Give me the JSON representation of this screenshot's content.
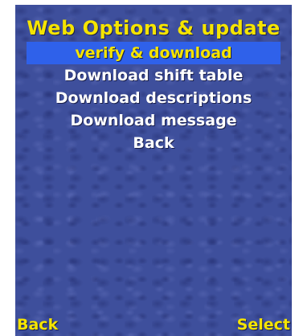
{
  "screen": {
    "title": "Web Options & update"
  },
  "menu": {
    "items": [
      {
        "label": "verify & download",
        "selected": true
      },
      {
        "label": "Download shift table",
        "selected": false
      },
      {
        "label": "Download descriptions",
        "selected": false
      },
      {
        "label": "Download message",
        "selected": false
      },
      {
        "label": "Back",
        "selected": false
      }
    ]
  },
  "softkeys": {
    "left": "Back",
    "right": "Select"
  },
  "colors": {
    "background": "#3e4f9c",
    "highlight": "#2f61ea",
    "title_text": "#f5e400",
    "menu_text": "#ffffff",
    "selected_text": "#f5e400"
  }
}
